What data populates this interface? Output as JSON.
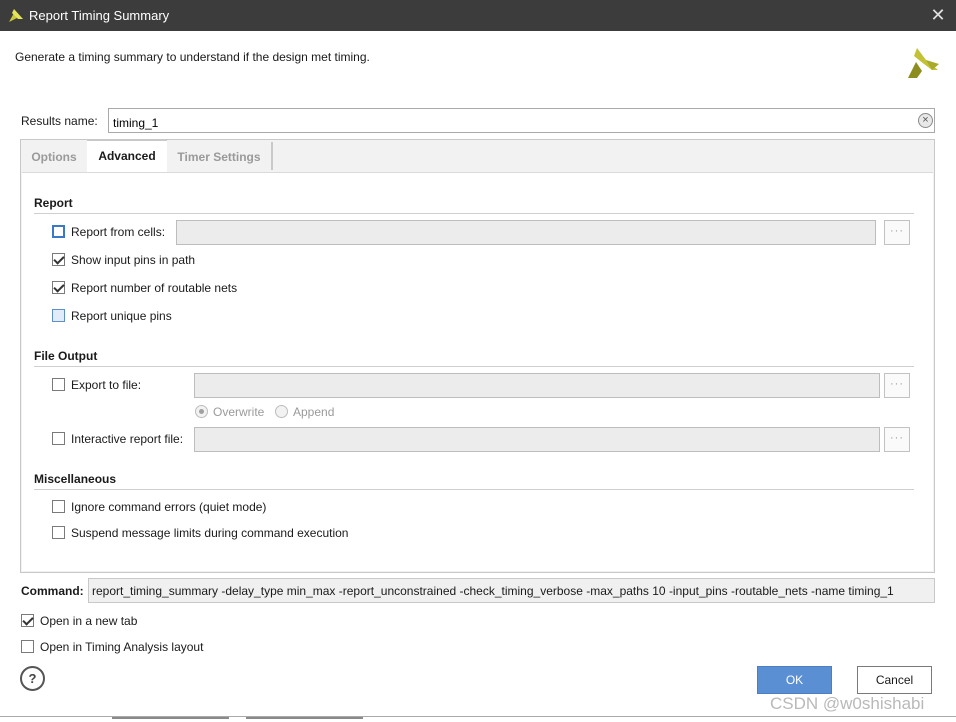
{
  "window": {
    "title": "Report Timing Summary",
    "close_glyph": "✕"
  },
  "description": "Generate a timing summary to understand if the design met timing.",
  "results_name": {
    "label": "Results name:",
    "value": "timing_1"
  },
  "tabs": [
    {
      "label": "Options",
      "active": false
    },
    {
      "label": "Advanced",
      "active": true
    },
    {
      "label": "Timer Settings",
      "active": false
    }
  ],
  "report_section": {
    "title": "Report",
    "report_from_cells": {
      "label": "Report from cells:",
      "checked": false,
      "value": ""
    },
    "show_input_pins": {
      "label": "Show input pins in path",
      "checked": true
    },
    "report_routable_nets": {
      "label": "Report number of routable nets",
      "checked": true
    },
    "report_unique_pins": {
      "label": "Report unique pins",
      "checked": false
    }
  },
  "file_output": {
    "title": "File Output",
    "export_to_file": {
      "label": "Export to file:",
      "checked": false,
      "value": ""
    },
    "overwrite": {
      "label": "Overwrite",
      "selected": true
    },
    "append": {
      "label": "Append",
      "selected": false
    },
    "interactive_report_file": {
      "label": "Interactive report file:",
      "checked": false,
      "value": ""
    }
  },
  "misc": {
    "title": "Miscellaneous",
    "ignore_errors": {
      "label": "Ignore command errors (quiet mode)",
      "checked": false
    },
    "suspend_limits": {
      "label": "Suspend message limits during command execution",
      "checked": false
    }
  },
  "browse_glyph": "···",
  "command": {
    "label": "Command:",
    "value": "report_timing_summary -delay_type min_max -report_unconstrained -check_timing_verbose -max_paths 10 -input_pins -routable_nets -name timing_1"
  },
  "open_new_tab": {
    "label": "Open in a new tab",
    "checked": true
  },
  "open_timing_layout": {
    "label": "Open in Timing Analysis layout",
    "checked": false
  },
  "help_glyph": "?",
  "buttons": {
    "ok": "OK",
    "cancel": "Cancel"
  },
  "watermark": "CSDN @w0shishabi",
  "colors": {
    "titlebar": "#3c3c3c",
    "ok_button": "#5b8fd3",
    "logo_yellow": "#b5b524",
    "logo_dark": "#6e6e14"
  }
}
